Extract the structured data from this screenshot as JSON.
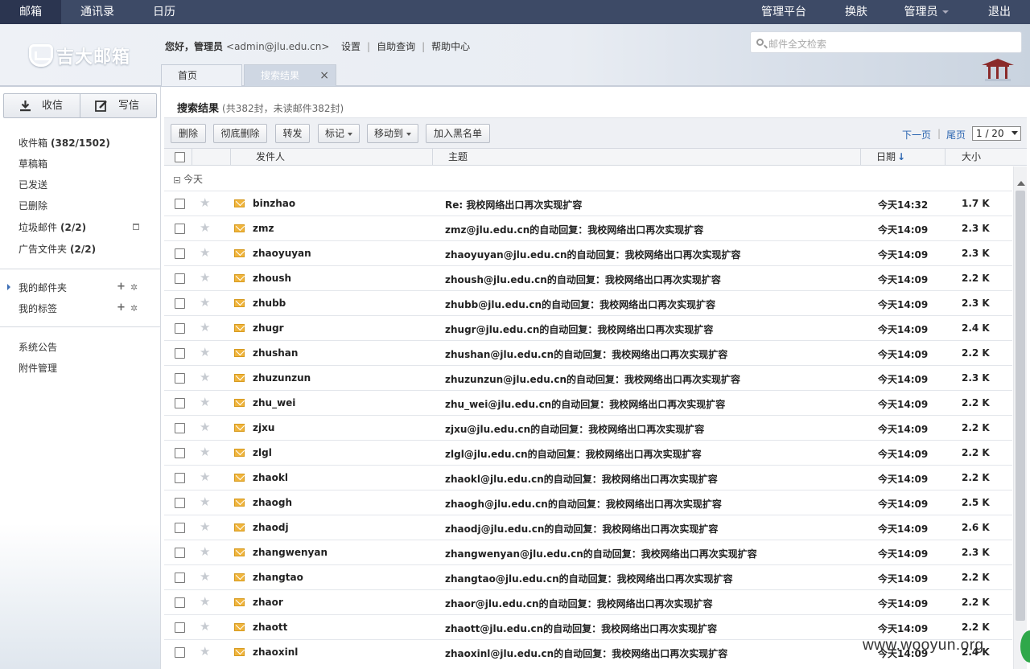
{
  "topnav": {
    "items": [
      "邮箱",
      "通讯录",
      "日历"
    ],
    "right": [
      "管理平台",
      "换肤",
      "管理员",
      "退出"
    ]
  },
  "header": {
    "logo_text": "吉大邮箱",
    "greeting": "您好，管理员",
    "email": "<admin@jlu.edu.cn>",
    "links": [
      "设置",
      "自助查询",
      "帮助中心"
    ],
    "search_placeholder": "邮件全文检索",
    "tabs": [
      "首页",
      "搜索结果"
    ],
    "tab_close": "×"
  },
  "sidebar": {
    "receive": "收信",
    "compose": "写信",
    "folders": [
      {
        "label": "收件箱",
        "count": "(382/1502)"
      },
      {
        "label": "草稿箱",
        "count": ""
      },
      {
        "label": "已发送",
        "count": ""
      },
      {
        "label": "已删除",
        "count": ""
      },
      {
        "label": "垃圾邮件",
        "count": "(2/2)"
      },
      {
        "label": "广告文件夹",
        "count": "(2/2)"
      }
    ],
    "my_folders": "我的邮件夹",
    "my_tags": "我的标签",
    "plus": "+",
    "gear": "✲",
    "announcements": "系统公告",
    "attachments": "附件管理"
  },
  "main": {
    "title": "搜索结果",
    "subtitle": "(共382封，未读邮件382封)",
    "toolbar": [
      "删除",
      "彻底删除",
      "转发",
      "标记",
      "移动到",
      "加入黑名单"
    ],
    "pager": {
      "next": "下一页",
      "last": "尾页",
      "page": "1 / 20"
    },
    "columns": {
      "sender": "发件人",
      "subject": "主题",
      "date": "日期",
      "date_arrow": "↓",
      "size": "大小"
    },
    "group": "今天",
    "star": "★",
    "rows": [
      {
        "sender": "binzhao",
        "subject": "Re: 我校网络出口再次实现扩容",
        "date": "今天14:32",
        "size": "1.7 K"
      },
      {
        "sender": "zmz",
        "subject": "zmz@jlu.edu.cn的自动回复：我校网络出口再次实现扩容",
        "date": "今天14:09",
        "size": "2.3 K"
      },
      {
        "sender": "zhaoyuyan",
        "subject": "zhaoyuyan@jlu.edu.cn的自动回复：我校网络出口再次实现扩容",
        "date": "今天14:09",
        "size": "2.3 K"
      },
      {
        "sender": "zhoush",
        "subject": "zhoush@jlu.edu.cn的自动回复：我校网络出口再次实现扩容",
        "date": "今天14:09",
        "size": "2.2 K"
      },
      {
        "sender": "zhubb",
        "subject": "zhubb@jlu.edu.cn的自动回复：我校网络出口再次实现扩容",
        "date": "今天14:09",
        "size": "2.3 K"
      },
      {
        "sender": "zhugr",
        "subject": "zhugr@jlu.edu.cn的自动回复：我校网络出口再次实现扩容",
        "date": "今天14:09",
        "size": "2.4 K"
      },
      {
        "sender": "zhushan",
        "subject": "zhushan@jlu.edu.cn的自动回复：我校网络出口再次实现扩容",
        "date": "今天14:09",
        "size": "2.2 K"
      },
      {
        "sender": "zhuzunzun",
        "subject": "zhuzunzun@jlu.edu.cn的自动回复：我校网络出口再次实现扩容",
        "date": "今天14:09",
        "size": "2.3 K"
      },
      {
        "sender": "zhu_wei",
        "subject": "zhu_wei@jlu.edu.cn的自动回复：我校网络出口再次实现扩容",
        "date": "今天14:09",
        "size": "2.2 K"
      },
      {
        "sender": "zjxu",
        "subject": "zjxu@jlu.edu.cn的自动回复：我校网络出口再次实现扩容",
        "date": "今天14:09",
        "size": "2.2 K"
      },
      {
        "sender": "zlgl",
        "subject": "zlgl@jlu.edu.cn的自动回复：我校网络出口再次实现扩容",
        "date": "今天14:09",
        "size": "2.2 K"
      },
      {
        "sender": "zhaokl",
        "subject": "zhaokl@jlu.edu.cn的自动回复：我校网络出口再次实现扩容",
        "date": "今天14:09",
        "size": "2.2 K"
      },
      {
        "sender": "zhaogh",
        "subject": "zhaogh@jlu.edu.cn的自动回复：我校网络出口再次实现扩容",
        "date": "今天14:09",
        "size": "2.5 K"
      },
      {
        "sender": "zhaodj",
        "subject": "zhaodj@jlu.edu.cn的自动回复：我校网络出口再次实现扩容",
        "date": "今天14:09",
        "size": "2.6 K"
      },
      {
        "sender": "zhangwenyan",
        "subject": "zhangwenyan@jlu.edu.cn的自动回复：我校网络出口再次实现扩容",
        "date": "今天14:09",
        "size": "2.3 K"
      },
      {
        "sender": "zhangtao",
        "subject": "zhangtao@jlu.edu.cn的自动回复：我校网络出口再次实现扩容",
        "date": "今天14:09",
        "size": "2.2 K"
      },
      {
        "sender": "zhaor",
        "subject": "zhaor@jlu.edu.cn的自动回复：我校网络出口再次实现扩容",
        "date": "今天14:09",
        "size": "2.2 K"
      },
      {
        "sender": "zhaott",
        "subject": "zhaott@jlu.edu.cn的自动回复：我校网络出口再次实现扩容",
        "date": "今天14:09",
        "size": "2.2 K"
      },
      {
        "sender": "zhaoxinl",
        "subject": "zhaoxinl@jlu.edu.cn的自动回复：我校网络出口再次实现扩容",
        "date": "今天14:09",
        "size": "2.4 K"
      }
    ]
  },
  "watermark": "www.wooyun.org"
}
